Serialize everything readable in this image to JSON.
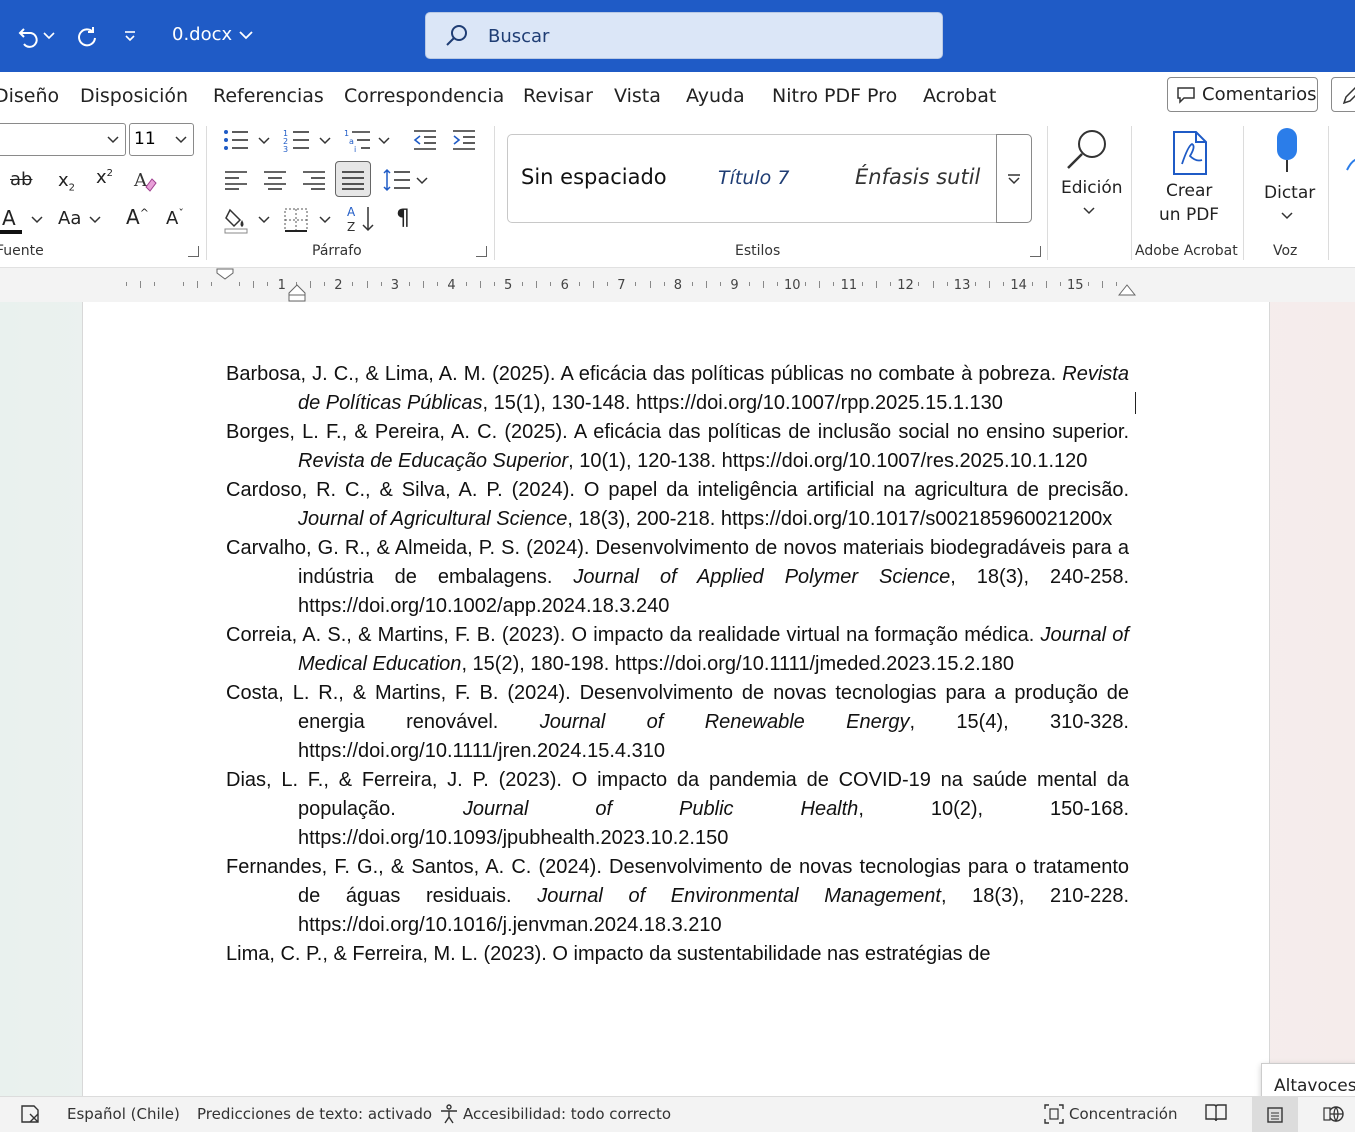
{
  "titlebar": {
    "document_name": "0.docx",
    "search_placeholder": "Buscar",
    "icons": [
      "undo-icon",
      "redo-icon",
      "customize-icon",
      "chevron-down-icon",
      "search-icon"
    ]
  },
  "tabs": [
    "Diseño",
    "Disposición",
    "Referencias",
    "Correspondencia",
    "Revisar",
    "Vista",
    "Ayuda",
    "Nitro PDF Pro",
    "Acrobat"
  ],
  "comments_label": "Comentarios",
  "ribbon": {
    "font_size": "11",
    "group_font": "Fuente",
    "group_paragraph": "Párrafo",
    "group_styles": "Estilos",
    "styles": [
      "Sin espaciado",
      "Título 7",
      "Énfasis sutil"
    ],
    "edicion_label": "Edición",
    "crear_pdf_line1": "Crear",
    "crear_pdf_line2": "un PDF",
    "group_adobe": "Adobe Acrobat",
    "dictar_label": "Dictar",
    "group_voz": "Voz",
    "font_color": "#e81123",
    "accent": "#1f5bc6"
  },
  "ruler_numbers": [
    "1",
    "2",
    "3",
    "4",
    "5",
    "6",
    "7",
    "8",
    "9",
    "10",
    "11",
    "12",
    "13",
    "14",
    "15"
  ],
  "references": [
    {
      "before": "Barbosa, J. C., & Lima, A. M. (2025). A eficácia das políticas públicas no combate à pobreza. ",
      "journal": "Revista de Políticas Públicas",
      "after": ", 15(1), 130-148. https://doi.org/10.1007/rpp.2025.15.1.130"
    },
    {
      "before": "Borges, L. F., & Pereira, A. C. (2025). A eficácia das políticas de inclusão social no ensino superior. ",
      "journal": "Revista de Educação Superior",
      "after": ", 10(1), 120-138. https://doi.org/10.1007/res.2025.10.1.120"
    },
    {
      "before": "Cardoso, R. C., & Silva, A. P. (2024). O papel da inteligência artificial na agricultura de precisão. ",
      "journal": "Journal of Agricultural Science",
      "after": ", 18(3), 200-218. https://doi.org/10.1017/s002185960021200x"
    },
    {
      "before": "Carvalho, G. R., & Almeida, P. S. (2024). Desenvolvimento de novos materiais biodegradáveis para a indústria de embalagens. ",
      "journal": "Journal of Applied Polymer Science",
      "after": ", 18(3), 240-258. https://doi.org/10.1002/app.2024.18.3.240"
    },
    {
      "before": "Correia, A. S., & Martins, F. B. (2023). O impacto da realidade virtual na formação médica. ",
      "journal": "Journal of Medical Education",
      "after": ", 15(2), 180-198. https://doi.org/10.1111/jmeded.2023.15.2.180"
    },
    {
      "before": "Costa, L. R., & Martins, F. B. (2024). Desenvolvimento de novas tecnologias para a produção de energia renovável. ",
      "journal": "Journal of Renewable Energy",
      "after": ", 15(4), 310-328. https://doi.org/10.1111/jren.2024.15.4.310"
    },
    {
      "before": "Dias, L. F., & Ferreira, J. P. (2023). O impacto da pandemia de COVID-19 na saúde mental da população. ",
      "journal": "Journal of Public Health",
      "after": ", 10(2), 150-168. https://doi.org/10.1093/jpubhealth.2023.10.2.150"
    },
    {
      "before": "Fernandes, F. G., & Santos, A. C. (2024). Desenvolvimento de novas tecnologias para o tratamento de águas residuais. ",
      "journal": "Journal of Environmental Management",
      "after": ", 18(3), 210-228. https://doi.org/10.1016/j.jenvman.2024.18.3.210"
    },
    {
      "before": "Lima, C. P., & Ferreira, M. L. (2023). O impacto da sustentabilidade nas estratégias de",
      "journal": "",
      "after": ""
    }
  ],
  "status": {
    "language": "Español (Chile)",
    "predictions": "Predicciones de texto: activado",
    "accessibility": "Accesibilidad: todo correcto",
    "focus": "Concentración"
  },
  "tooltip": "Altavoces"
}
